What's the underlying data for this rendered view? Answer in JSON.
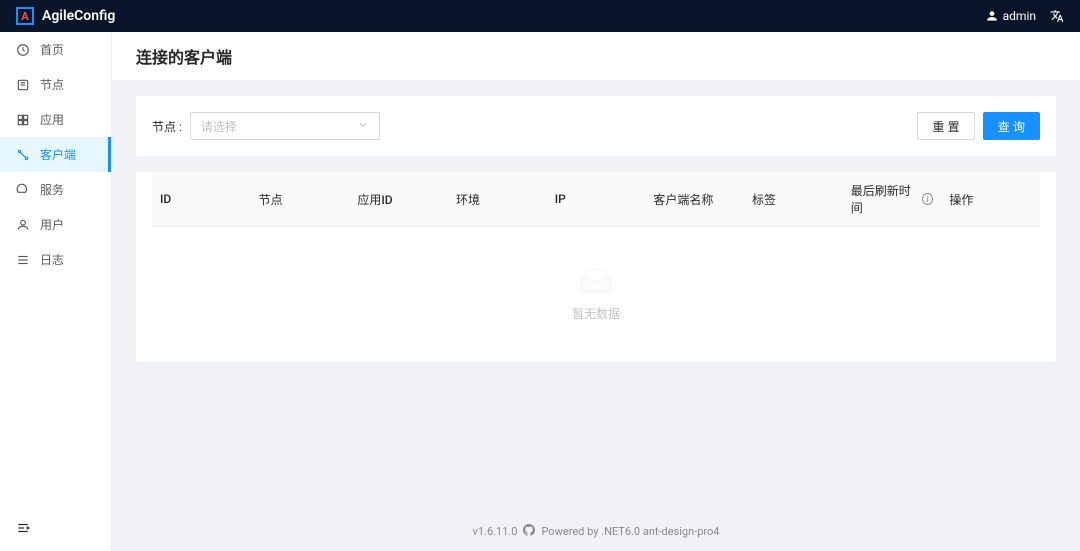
{
  "app": {
    "name": "AgileConfig"
  },
  "header": {
    "user": "admin"
  },
  "sidebar": {
    "items": [
      {
        "label": "首页",
        "icon": "dashboard"
      },
      {
        "label": "节点",
        "icon": "node"
      },
      {
        "label": "应用",
        "icon": "app"
      },
      {
        "label": "客户端",
        "icon": "client"
      },
      {
        "label": "服务",
        "icon": "service"
      },
      {
        "label": "用户",
        "icon": "user"
      },
      {
        "label": "日志",
        "icon": "log"
      }
    ]
  },
  "page": {
    "title": "连接的客户端"
  },
  "filter": {
    "node_label": "节点 :",
    "node_placeholder": "请选择",
    "reset_label": "重 置",
    "query_label": "查 询"
  },
  "table": {
    "columns": {
      "id": "ID",
      "node": "节点",
      "appid": "应用ID",
      "env": "环境",
      "ip": "IP",
      "client_name": "客户端名称",
      "tag": "标签",
      "last_refresh": "最后刷新时间",
      "operation": "操作"
    },
    "empty_text": "暂无数据"
  },
  "footer": {
    "version": "v1.6.11.0",
    "powered": "Powered by .NET6.0 ant-design-pro4"
  }
}
